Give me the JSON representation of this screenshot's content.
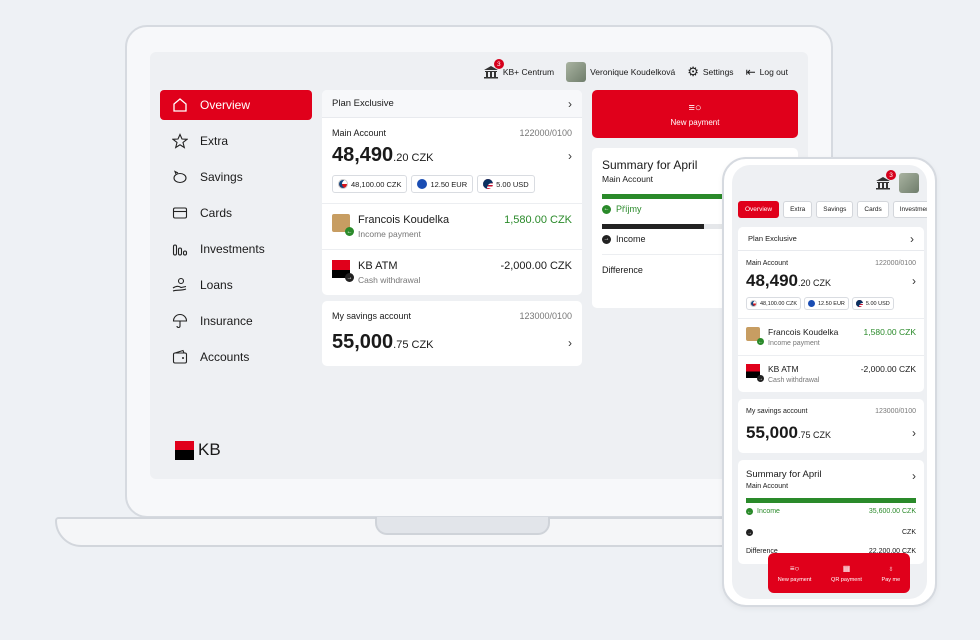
{
  "topbar": {
    "center_label": "KB+ Centrum",
    "center_badge": "3",
    "user_name": "Veronique Koudelková",
    "settings_label": "Settings",
    "logout_label": "Log out"
  },
  "sidebar": {
    "items": [
      {
        "label": "Overview",
        "icon": "home-icon",
        "active": true
      },
      {
        "label": "Extra",
        "icon": "star-icon"
      },
      {
        "label": "Savings",
        "icon": "piggy-bank-icon"
      },
      {
        "label": "Cards",
        "icon": "card-icon"
      },
      {
        "label": "Investments",
        "icon": "chart-bars-icon"
      },
      {
        "label": "Loans",
        "icon": "hand-coins-icon"
      },
      {
        "label": "Insurance",
        "icon": "umbrella-icon"
      },
      {
        "label": "Accounts",
        "icon": "wallet-icon"
      }
    ],
    "logo_text": "KB"
  },
  "main": {
    "plan_label": "Plan Exclusive",
    "main_account": {
      "name": "Main Account",
      "number": "122000/0100",
      "amount_int": "48,490",
      "amount_dec": ".20 CZK",
      "chips": [
        "48,100.00 CZK",
        "12.50 EUR",
        "5.00 USD"
      ]
    },
    "transactions": [
      {
        "name": "Francois Koudelka",
        "sub": "Income payment",
        "value": "1,580.00 CZK"
      },
      {
        "name": "KB ATM",
        "sub": "Cash withdrawal",
        "value": "-2,000.00 CZK"
      }
    ],
    "savings_account": {
      "name": "My savings account",
      "number": "123000/0100",
      "amount_int": "55,000",
      "amount_dec": ".75 CZK"
    }
  },
  "right": {
    "new_payment_label": "New payment",
    "summary_title": "Summary for April",
    "summary_sub": "Main Account",
    "prijmy_label": "Příjmy",
    "income_label": "Income",
    "difference_label": "Difference"
  },
  "phone": {
    "badge": "3",
    "tabs": [
      "Overview",
      "Extra",
      "Savings",
      "Cards",
      "Investmen"
    ],
    "summary_income_value": "35,600.00 CZK",
    "difference_value": "22,200.00 CZK",
    "partial_value": "CZK",
    "actions": [
      "New payment",
      "QR payment",
      "Pay me"
    ]
  },
  "colors": {
    "brand_red": "#e0001b",
    "income_green": "#2a8a2a"
  }
}
